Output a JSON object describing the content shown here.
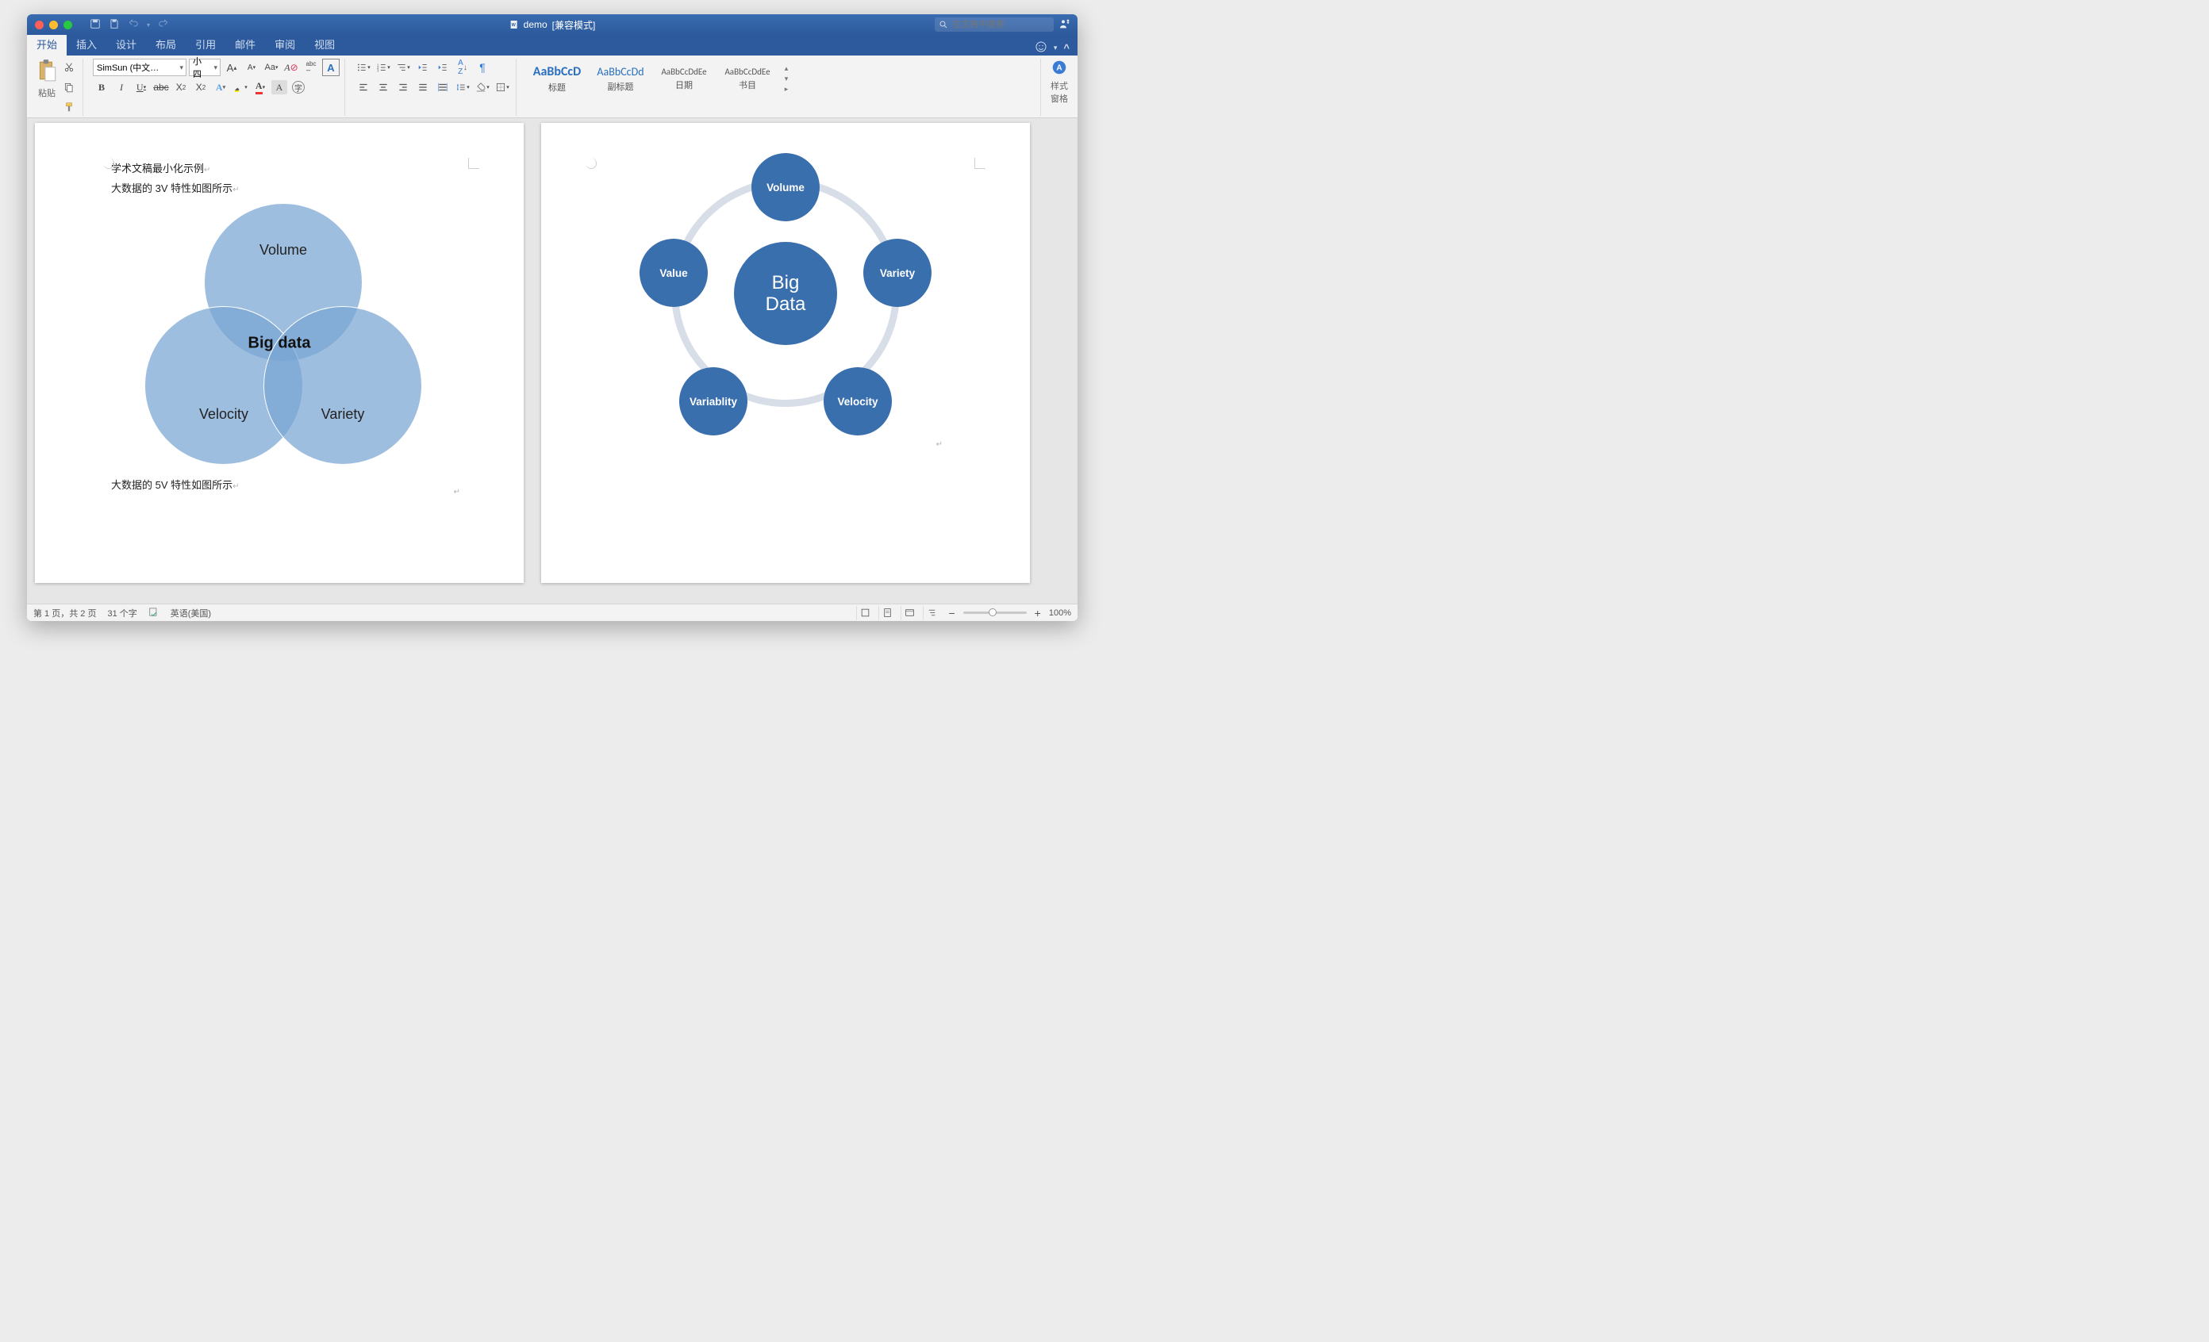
{
  "title": {
    "doc_name": "demo",
    "suffix": "[兼容模式]"
  },
  "search": {
    "placeholder": "在文档中搜索"
  },
  "tabs": [
    "开始",
    "插入",
    "设计",
    "布局",
    "引用",
    "邮件",
    "审阅",
    "视图"
  ],
  "active_tab": 0,
  "ribbon": {
    "paste_label": "粘贴",
    "font_name": "SimSun (中文…",
    "font_size": "小四",
    "styles": [
      {
        "preview": "AaBbCcD",
        "label": "标题"
      },
      {
        "preview": "AaBbCcDd",
        "label": "副标题"
      },
      {
        "preview": "AaBbCcDdEe",
        "label": "日期"
      },
      {
        "preview": "AaBbCcDdEe",
        "label": "书目"
      }
    ],
    "styles_pane_label": "样式\n窗格"
  },
  "document": {
    "p1_line1": "学术文稿最小化示例",
    "p1_line2": "大数据的 3V 特性如图所示",
    "p1_line3": "大数据的 5V 特性如图所示",
    "venn": {
      "center": "Big data",
      "c1": "Volume",
      "c2": "Velocity",
      "c3": "Variety"
    },
    "fivev": {
      "center": "Big\nData",
      "nodes": [
        "Volume",
        "Variety",
        "Velocity",
        "Variablity",
        "Value"
      ]
    }
  },
  "status": {
    "page": "第 1 页，共 2 页",
    "words": "31 个字",
    "lang": "英语(美国)",
    "zoom": "100%"
  }
}
